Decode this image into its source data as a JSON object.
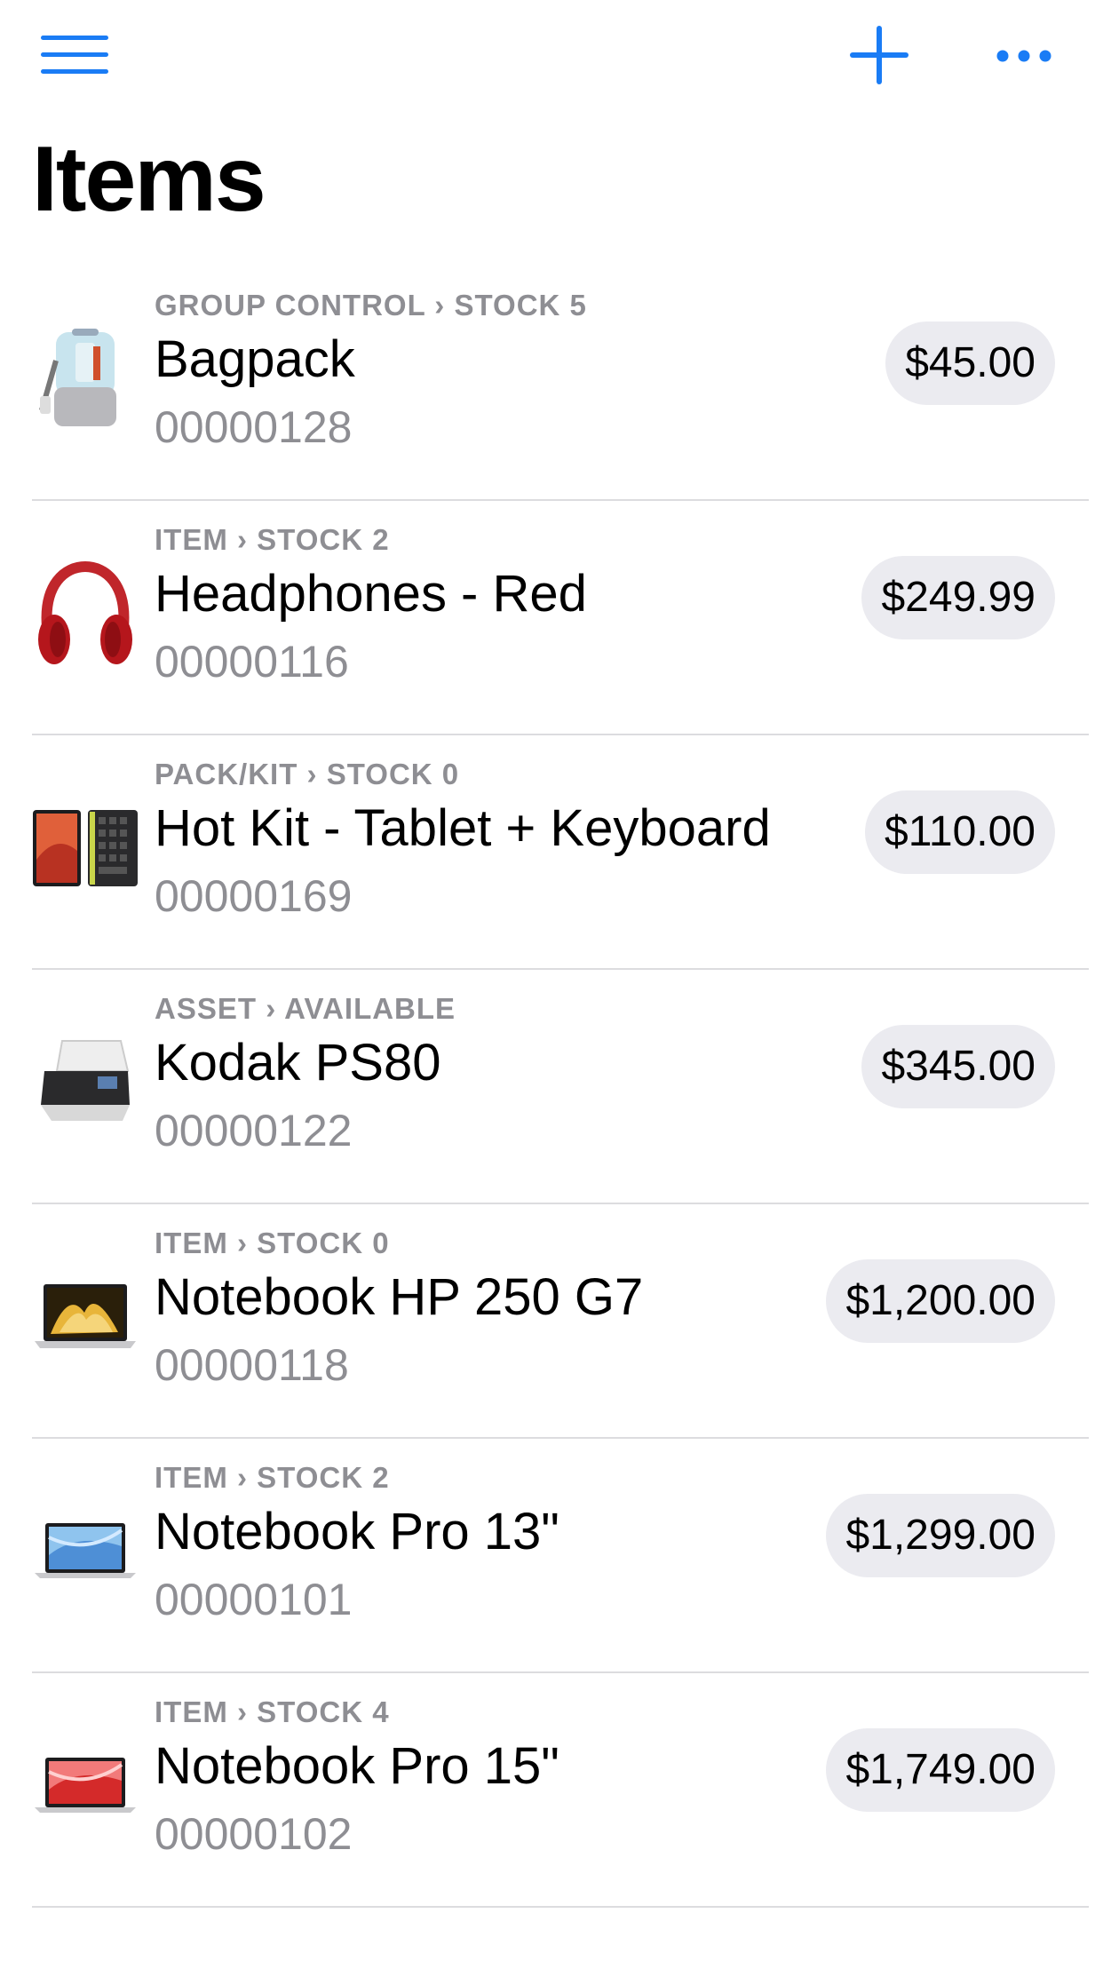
{
  "header": {
    "title": "Items",
    "menu_icon": "hamburger-menu-icon",
    "add_icon": "plus-icon",
    "more_icon": "ellipsis-icon",
    "accent_color": "#1a7cf5"
  },
  "items": [
    {
      "category": "GROUP CONTROL › STOCK 5",
      "name": "Bagpack",
      "code": "00000128",
      "price": "$45.00",
      "image": "backpack-image"
    },
    {
      "category": "ITEM › STOCK 2",
      "name": "Headphones - Red",
      "code": "00000116",
      "price": "$249.99",
      "image": "red-headphones-image"
    },
    {
      "category": "PACK/KIT › STOCK 0",
      "name": "Hot Kit - Tablet + Keyboard",
      "code": "00000169",
      "price": "$110.00",
      "image": "tablet-keyboard-image"
    },
    {
      "category": "ASSET › AVAILABLE",
      "name": "Kodak PS80",
      "code": "00000122",
      "price": "$345.00",
      "image": "scanner-image"
    },
    {
      "category": "ITEM › STOCK 0",
      "name": "Notebook HP 250 G7",
      "code": "00000118",
      "price": "$1,200.00",
      "image": "gold-laptop-image"
    },
    {
      "category": "ITEM › STOCK 2",
      "name": "Notebook Pro 13\"",
      "code": "00000101",
      "price": "$1,299.00",
      "image": "blue-laptop-image"
    },
    {
      "category": "ITEM › STOCK 4",
      "name": "Notebook Pro 15\"",
      "code": "00000102",
      "price": "$1,749.00",
      "image": "red-laptop-image"
    }
  ]
}
